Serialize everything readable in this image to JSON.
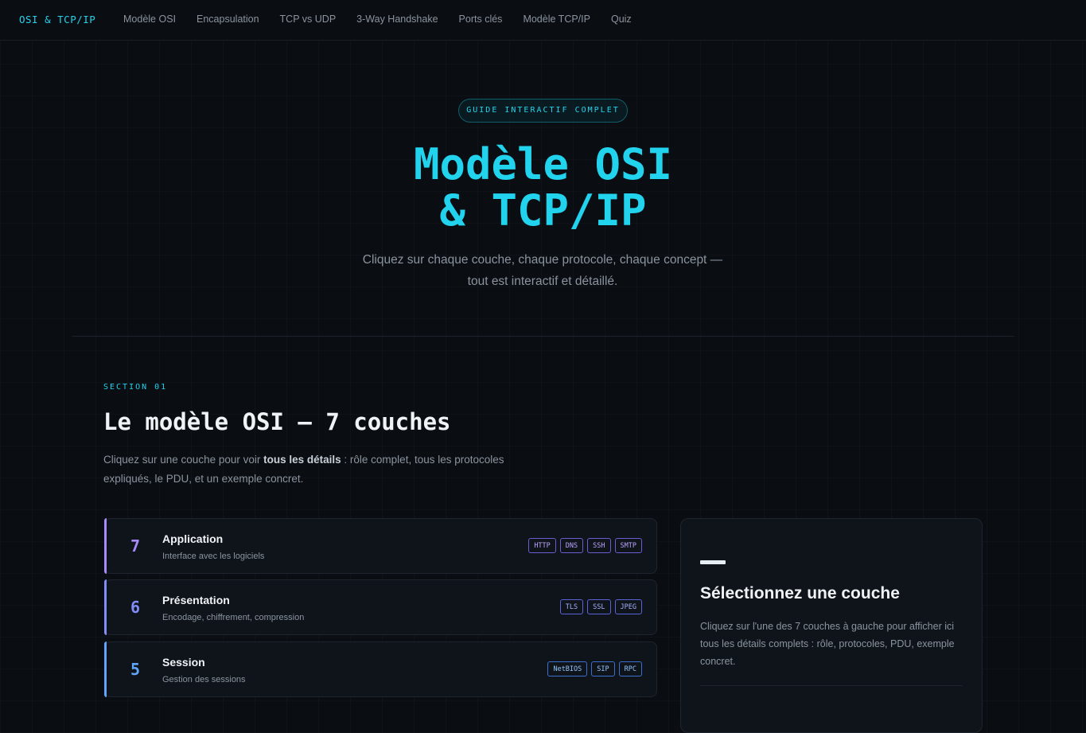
{
  "nav": {
    "brand": "OSI & TCP/IP",
    "links": [
      "Modèle OSI",
      "Encapsulation",
      "TCP vs UDP",
      "3-Way Handshake",
      "Ports clés",
      "Modèle TCP/IP",
      "Quiz"
    ]
  },
  "hero": {
    "badge": "GUIDE INTERACTIF COMPLET",
    "title_line1": "Modèle OSI",
    "title_line2": "& TCP/IP",
    "subtitle_line1": "Cliquez sur chaque couche, chaque protocole, chaque concept —",
    "subtitle_line2": "tout est interactif et détaillé."
  },
  "section": {
    "kicker": "SECTION 01",
    "title": "Le modèle OSI — 7 couches",
    "desc_before": "Cliquez sur une couche pour voir ",
    "desc_bold": "tous les détails",
    "desc_after": " : rôle complet, tous les protocoles expliqués, le PDU, et un exemple concret."
  },
  "layers": [
    {
      "num": "7",
      "name": "Application",
      "desc": "Interface avec les logiciels",
      "tags": [
        "HTTP",
        "DNS",
        "SSH",
        "SMTP"
      ]
    },
    {
      "num": "6",
      "name": "Présentation",
      "desc": "Encodage, chiffrement, compression",
      "tags": [
        "TLS",
        "SSL",
        "JPEG"
      ]
    },
    {
      "num": "5",
      "name": "Session",
      "desc": "Gestion des sessions",
      "tags": [
        "NetBIOS",
        "SIP",
        "RPC"
      ]
    }
  ],
  "panel": {
    "title": "Sélectionnez une couche",
    "text": "Cliquez sur l'une des 7 couches à gauche pour afficher ici tous les détails complets : rôle, protocoles, PDU, exemple concret."
  },
  "colors": {
    "accent": "#22d3ee",
    "layer7": "#a78bfa",
    "layer6": "#818cf8",
    "layer5": "#60a5fa",
    "background": "#0a0d12"
  }
}
